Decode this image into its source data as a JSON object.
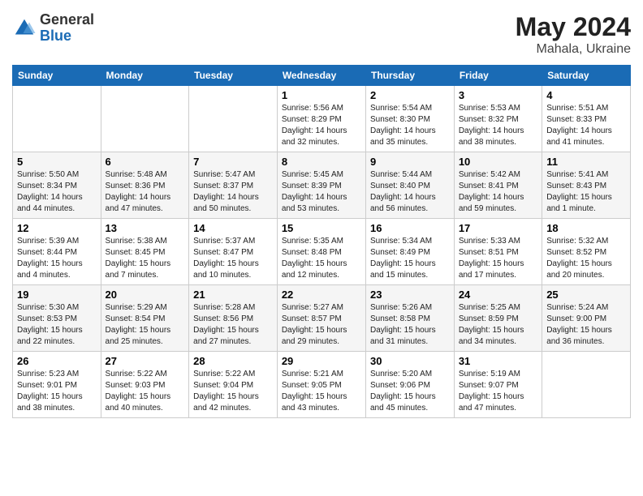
{
  "header": {
    "logo_general": "General",
    "logo_blue": "Blue",
    "month_year": "May 2024",
    "location": "Mahala, Ukraine"
  },
  "weekdays": [
    "Sunday",
    "Monday",
    "Tuesday",
    "Wednesday",
    "Thursday",
    "Friday",
    "Saturday"
  ],
  "weeks": [
    [
      {
        "day": "",
        "info": ""
      },
      {
        "day": "",
        "info": ""
      },
      {
        "day": "",
        "info": ""
      },
      {
        "day": "1",
        "info": "Sunrise: 5:56 AM\nSunset: 8:29 PM\nDaylight: 14 hours\nand 32 minutes."
      },
      {
        "day": "2",
        "info": "Sunrise: 5:54 AM\nSunset: 8:30 PM\nDaylight: 14 hours\nand 35 minutes."
      },
      {
        "day": "3",
        "info": "Sunrise: 5:53 AM\nSunset: 8:32 PM\nDaylight: 14 hours\nand 38 minutes."
      },
      {
        "day": "4",
        "info": "Sunrise: 5:51 AM\nSunset: 8:33 PM\nDaylight: 14 hours\nand 41 minutes."
      }
    ],
    [
      {
        "day": "5",
        "info": "Sunrise: 5:50 AM\nSunset: 8:34 PM\nDaylight: 14 hours\nand 44 minutes."
      },
      {
        "day": "6",
        "info": "Sunrise: 5:48 AM\nSunset: 8:36 PM\nDaylight: 14 hours\nand 47 minutes."
      },
      {
        "day": "7",
        "info": "Sunrise: 5:47 AM\nSunset: 8:37 PM\nDaylight: 14 hours\nand 50 minutes."
      },
      {
        "day": "8",
        "info": "Sunrise: 5:45 AM\nSunset: 8:39 PM\nDaylight: 14 hours\nand 53 minutes."
      },
      {
        "day": "9",
        "info": "Sunrise: 5:44 AM\nSunset: 8:40 PM\nDaylight: 14 hours\nand 56 minutes."
      },
      {
        "day": "10",
        "info": "Sunrise: 5:42 AM\nSunset: 8:41 PM\nDaylight: 14 hours\nand 59 minutes."
      },
      {
        "day": "11",
        "info": "Sunrise: 5:41 AM\nSunset: 8:43 PM\nDaylight: 15 hours\nand 1 minute."
      }
    ],
    [
      {
        "day": "12",
        "info": "Sunrise: 5:39 AM\nSunset: 8:44 PM\nDaylight: 15 hours\nand 4 minutes."
      },
      {
        "day": "13",
        "info": "Sunrise: 5:38 AM\nSunset: 8:45 PM\nDaylight: 15 hours\nand 7 minutes."
      },
      {
        "day": "14",
        "info": "Sunrise: 5:37 AM\nSunset: 8:47 PM\nDaylight: 15 hours\nand 10 minutes."
      },
      {
        "day": "15",
        "info": "Sunrise: 5:35 AM\nSunset: 8:48 PM\nDaylight: 15 hours\nand 12 minutes."
      },
      {
        "day": "16",
        "info": "Sunrise: 5:34 AM\nSunset: 8:49 PM\nDaylight: 15 hours\nand 15 minutes."
      },
      {
        "day": "17",
        "info": "Sunrise: 5:33 AM\nSunset: 8:51 PM\nDaylight: 15 hours\nand 17 minutes."
      },
      {
        "day": "18",
        "info": "Sunrise: 5:32 AM\nSunset: 8:52 PM\nDaylight: 15 hours\nand 20 minutes."
      }
    ],
    [
      {
        "day": "19",
        "info": "Sunrise: 5:30 AM\nSunset: 8:53 PM\nDaylight: 15 hours\nand 22 minutes."
      },
      {
        "day": "20",
        "info": "Sunrise: 5:29 AM\nSunset: 8:54 PM\nDaylight: 15 hours\nand 25 minutes."
      },
      {
        "day": "21",
        "info": "Sunrise: 5:28 AM\nSunset: 8:56 PM\nDaylight: 15 hours\nand 27 minutes."
      },
      {
        "day": "22",
        "info": "Sunrise: 5:27 AM\nSunset: 8:57 PM\nDaylight: 15 hours\nand 29 minutes."
      },
      {
        "day": "23",
        "info": "Sunrise: 5:26 AM\nSunset: 8:58 PM\nDaylight: 15 hours\nand 31 minutes."
      },
      {
        "day": "24",
        "info": "Sunrise: 5:25 AM\nSunset: 8:59 PM\nDaylight: 15 hours\nand 34 minutes."
      },
      {
        "day": "25",
        "info": "Sunrise: 5:24 AM\nSunset: 9:00 PM\nDaylight: 15 hours\nand 36 minutes."
      }
    ],
    [
      {
        "day": "26",
        "info": "Sunrise: 5:23 AM\nSunset: 9:01 PM\nDaylight: 15 hours\nand 38 minutes."
      },
      {
        "day": "27",
        "info": "Sunrise: 5:22 AM\nSunset: 9:03 PM\nDaylight: 15 hours\nand 40 minutes."
      },
      {
        "day": "28",
        "info": "Sunrise: 5:22 AM\nSunset: 9:04 PM\nDaylight: 15 hours\nand 42 minutes."
      },
      {
        "day": "29",
        "info": "Sunrise: 5:21 AM\nSunset: 9:05 PM\nDaylight: 15 hours\nand 43 minutes."
      },
      {
        "day": "30",
        "info": "Sunrise: 5:20 AM\nSunset: 9:06 PM\nDaylight: 15 hours\nand 45 minutes."
      },
      {
        "day": "31",
        "info": "Sunrise: 5:19 AM\nSunset: 9:07 PM\nDaylight: 15 hours\nand 47 minutes."
      },
      {
        "day": "",
        "info": ""
      }
    ]
  ]
}
